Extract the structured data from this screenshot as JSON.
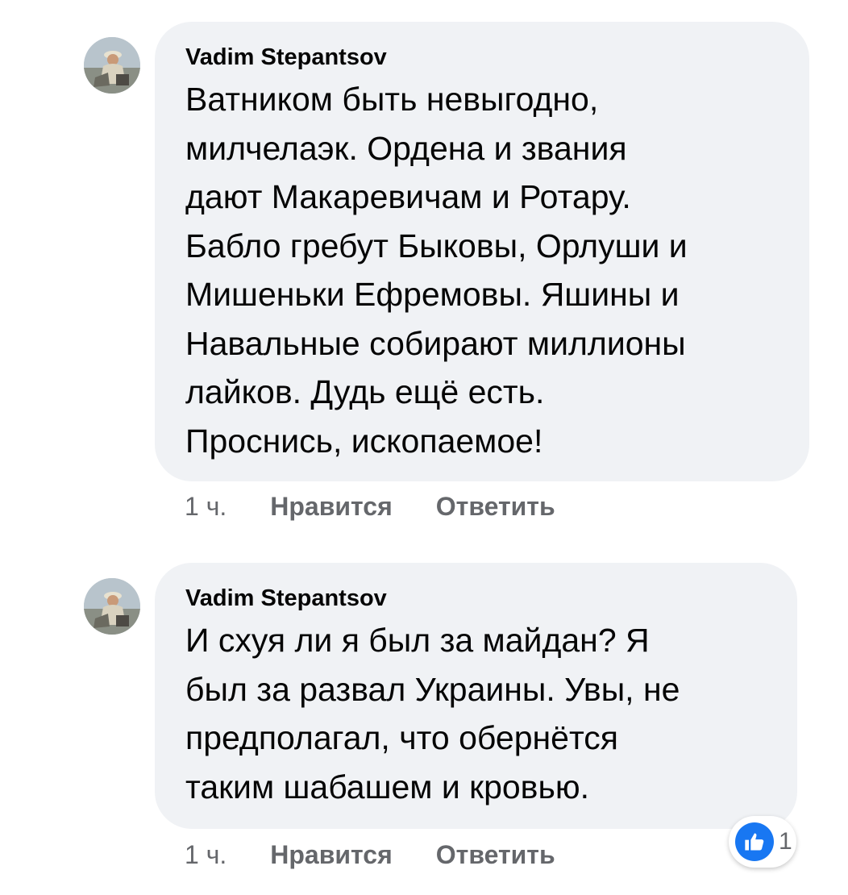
{
  "comments": [
    {
      "author": "Vadim Stepantsov",
      "text": "Ватником быть невыгодно,\nмилчелаэк. Ордена и звания\nдают Макаревичам и Ротару.\nБабло гребут Быковы, Орлуши и\nМишеньки Ефремовы. Яшины и\nНавальные собирают миллионы\nлайков. Дудь ещё есть.\nПроснись, ископаемое!",
      "time": "1 ч.",
      "like_label": "Нравится",
      "reply_label": "Ответить"
    },
    {
      "author": "Vadim Stepantsov",
      "text": "И схуя  ли я был за майдан? Я\nбыл за развал Украины. Увы, не\nпредполагал, что обернётся\nтаким шабашем и кровью.",
      "time": "1 ч.",
      "like_label": "Нравится",
      "reply_label": "Ответить",
      "reaction": {
        "icon": "thumbs-up-icon",
        "count": "1",
        "color": "#1877f2"
      }
    }
  ],
  "colors": {
    "bubble_bg": "#f0f2f5",
    "text": "#050505",
    "secondary_text": "#65676b",
    "like_blue": "#1877f2"
  }
}
